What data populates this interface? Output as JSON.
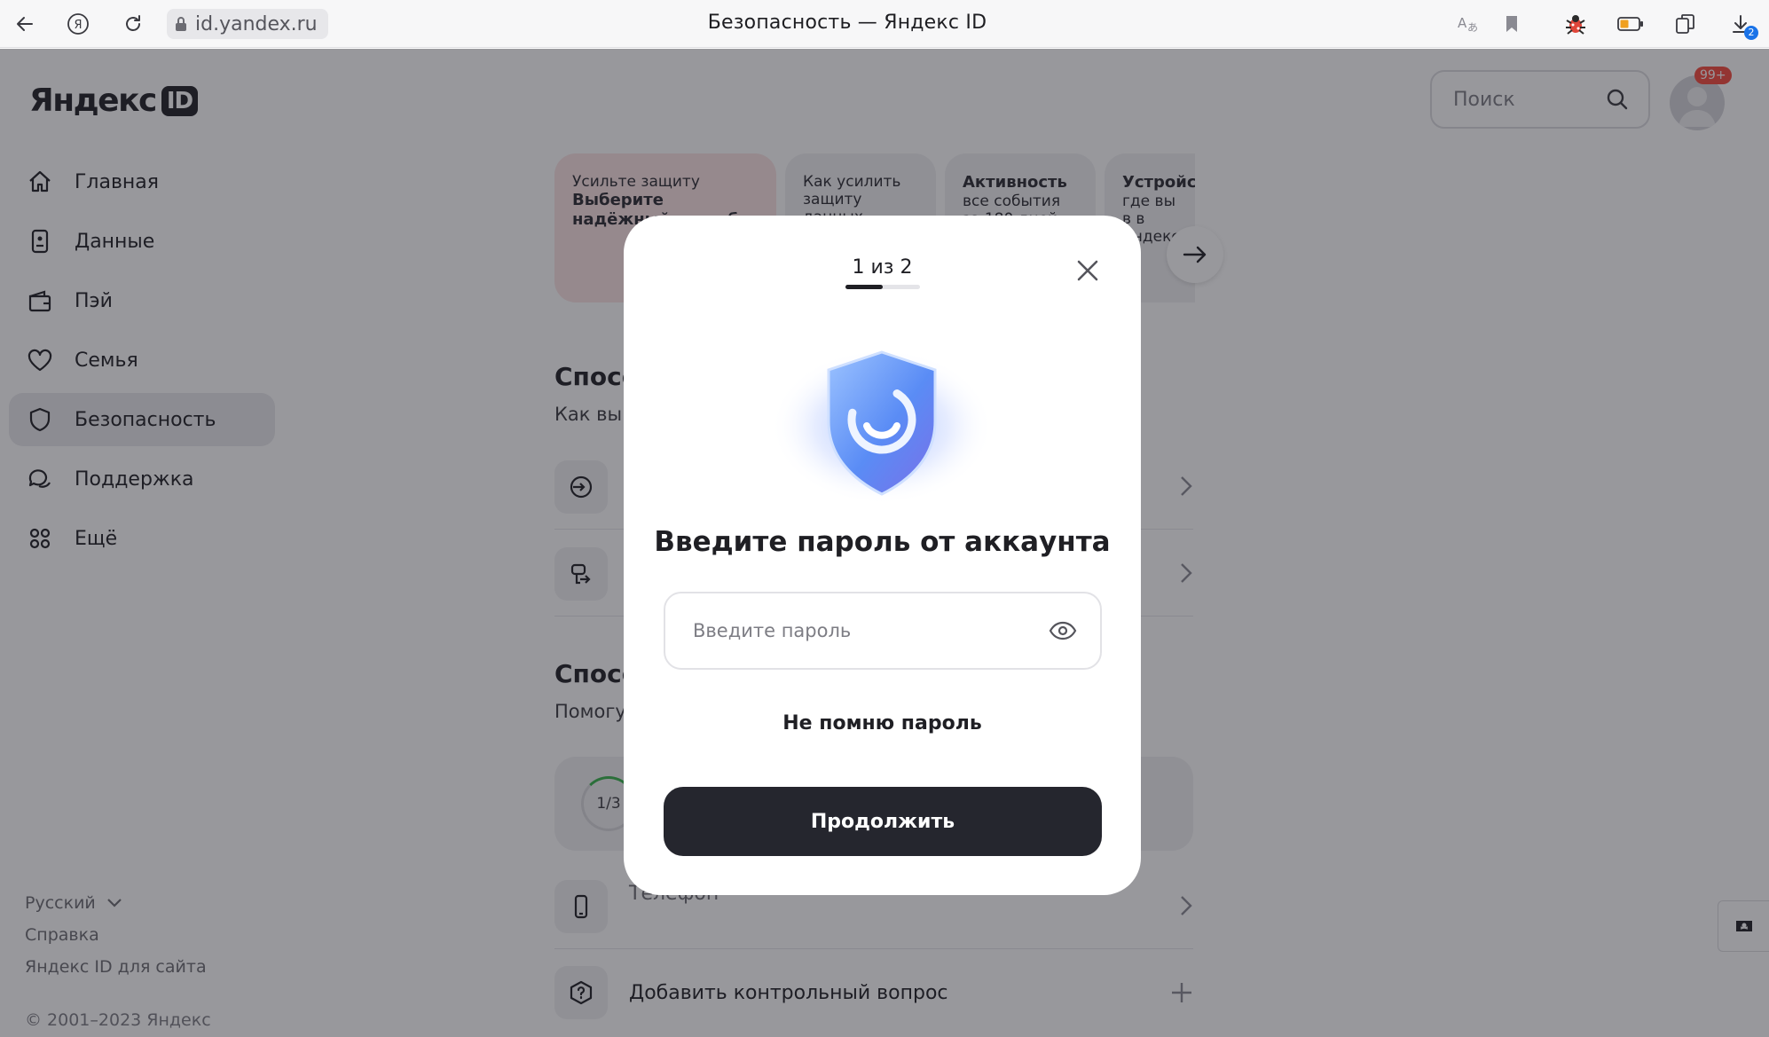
{
  "browser": {
    "url_host": "id.yandex.ru",
    "tab_title": "Безопасность — Яндекс ID",
    "downloads_badge": "2"
  },
  "header": {
    "logo_word": "Яндекс",
    "logo_id": "ID",
    "search_placeholder": "Поиск",
    "avatar_badge": "99+"
  },
  "sidebar": {
    "items": [
      {
        "label": "Главная",
        "icon": "home-icon"
      },
      {
        "label": "Данные",
        "icon": "id-card-icon"
      },
      {
        "label": "Пэй",
        "icon": "wallet-icon"
      },
      {
        "label": "Семья",
        "icon": "heart-icon"
      },
      {
        "label": "Безопасность",
        "icon": "shield-icon",
        "active": true
      },
      {
        "label": "Поддержка",
        "icon": "chat-icon"
      },
      {
        "label": "Ещё",
        "icon": "grid-icon"
      }
    ],
    "footer": {
      "language": "Русский",
      "help": "Справка",
      "for_site": "Яндекс ID для сайта",
      "copyright": "© 2001–2023 Яндекс"
    }
  },
  "background": {
    "cards": [
      {
        "sub": "Усильте защиту",
        "bold": "Выберите надёжный способ в"
      },
      {
        "sub": "Как усилить защиту данных"
      },
      {
        "bold": "Активность",
        "sub": "все события за 180 дней"
      },
      {
        "bold": "Устройства",
        "sub": "где вы в в Яндексе"
      }
    ],
    "section1_title": "Спосо",
    "section1_sub": "Как вы з",
    "section2_title": "Спосо",
    "section2_sub": "Помогу",
    "progress_label": "1/3",
    "phone_label": "Телефон",
    "security_question_label": "Добавить контрольный вопрос"
  },
  "modal": {
    "step_text": "1 из 2",
    "step_current": 1,
    "step_total": 2,
    "title": "Введите пароль от аккаунта",
    "password_placeholder": "Введите пароль",
    "password_value": "",
    "forgot_label": "Не помню пароль",
    "continue_label": "Продолжить"
  },
  "colors": {
    "accent_dark": "#25262e",
    "overlay": "rgba(30,30,40,0.46)",
    "badge_red": "#f5483c",
    "shield_blue": "#5a8cf5"
  }
}
